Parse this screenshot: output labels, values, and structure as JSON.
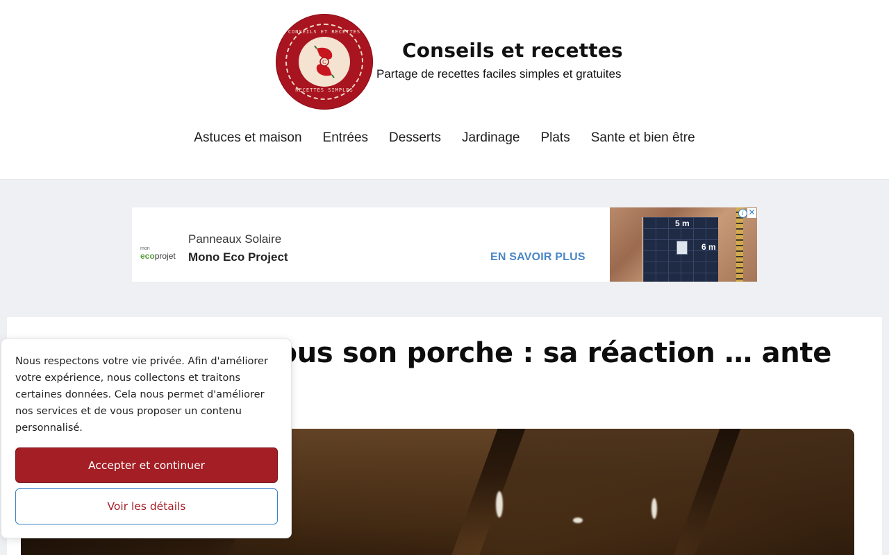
{
  "site": {
    "title": "Conseils et recettes",
    "tagline": "Partage de recettes faciles simples et gratuites",
    "logo": {
      "top_text": "CONSEILS ET RECETTES",
      "bottom_text": "RECETTES SIMPLES",
      "letter": "C",
      "color": "#a8141f"
    }
  },
  "nav": {
    "items": [
      {
        "label": "Astuces et maison"
      },
      {
        "label": "Entrées"
      },
      {
        "label": "Desserts"
      },
      {
        "label": "Jardinage"
      },
      {
        "label": "Plats"
      },
      {
        "label": "Sante et bien être"
      }
    ]
  },
  "ad": {
    "brand_small": "mon",
    "brand_main_eco": "eco",
    "brand_main_rest": "projet",
    "title": "Panneaux Solaire",
    "subtitle": "Mono Eco Project",
    "cta": "EN SAVOIR PLUS",
    "image_labels": [
      "5 m",
      "6 m"
    ],
    "info_icon": "i",
    "close_icon": "✕"
  },
  "article": {
    "title": "… taine d'œufs sous son porche : sa réaction … ante"
  },
  "cookie": {
    "text": "Nous respectons votre vie privée. Afin d'améliorer votre expérience, nous collectons et traitons certaines données. Cela nous permet d'améliorer nos services et de vous proposer un contenu personnalisé.",
    "accept_label": "Accepter et continuer",
    "details_label": "Voir les détails",
    "accent_color": "#a41e25"
  }
}
